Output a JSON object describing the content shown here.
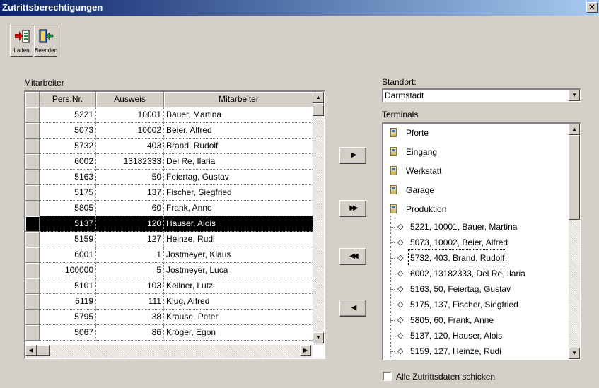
{
  "window": {
    "title": "Zutrittsberechtigungen",
    "close_glyph": "✕"
  },
  "toolbar": {
    "load_label": "Laden",
    "exit_label": "Beenden"
  },
  "employees": {
    "section_label": "Mitarbeiter",
    "columns": [
      "Pers.Nr.",
      "Ausweis",
      "Mitarbeiter"
    ],
    "rows": [
      {
        "pers": "5221",
        "ausweis": "10001",
        "name": "Bauer, Martina"
      },
      {
        "pers": "5073",
        "ausweis": "10002",
        "name": "Beier, Alfred"
      },
      {
        "pers": "5732",
        "ausweis": "403",
        "name": "Brand, Rudolf"
      },
      {
        "pers": "6002",
        "ausweis": "13182333",
        "name": "Del Re, Ilaria"
      },
      {
        "pers": "5163",
        "ausweis": "50",
        "name": "Feiertag, Gustav"
      },
      {
        "pers": "5175",
        "ausweis": "137",
        "name": "Fischer, Siegfried"
      },
      {
        "pers": "5805",
        "ausweis": "60",
        "name": "Frank, Anne"
      },
      {
        "pers": "5137",
        "ausweis": "120",
        "name": "Hauser, Alois"
      },
      {
        "pers": "5159",
        "ausweis": "127",
        "name": "Heinze, Rudi"
      },
      {
        "pers": "6001",
        "ausweis": "1",
        "name": "Jostmeyer, Klaus"
      },
      {
        "pers": "100000",
        "ausweis": "5",
        "name": "Jostmeyer, Luca"
      },
      {
        "pers": "5101",
        "ausweis": "103",
        "name": "Kellner, Lutz"
      },
      {
        "pers": "5119",
        "ausweis": "111",
        "name": "Klug, Alfred"
      },
      {
        "pers": "5795",
        "ausweis": "38",
        "name": "Krause, Peter"
      },
      {
        "pers": "5067",
        "ausweis": "86",
        "name": "Kröger, Egon"
      }
    ],
    "selected_index": 7
  },
  "transfer": {
    "add_one": "▶",
    "add_all": "▶▶",
    "remove_all": "◀◀",
    "remove_one": "◀"
  },
  "location": {
    "label": "Standort:",
    "value": "Darmstadt"
  },
  "terminals": {
    "label": "Terminals",
    "items": [
      "Pforte",
      "Eingang",
      "Werkstatt",
      "Garage",
      "Produktion"
    ],
    "entries": [
      "5221,  10001,  Bauer, Martina",
      "5073,  10002,  Beier, Alfred",
      "5732,  403,  Brand, Rudolf",
      "6002,  13182333,  Del Re, Ilaria",
      "5163,  50,  Feiertag, Gustav",
      "5175,  137,  Fischer, Siegfried",
      "5805,  60,  Frank, Anne",
      "5137,  120,  Hauser, Alois",
      "5159,  127,  Heinze, Rudi"
    ],
    "focused_entry_index": 2
  },
  "send_all": {
    "label": "Alle Zutrittsdaten schicken",
    "checked": false
  }
}
